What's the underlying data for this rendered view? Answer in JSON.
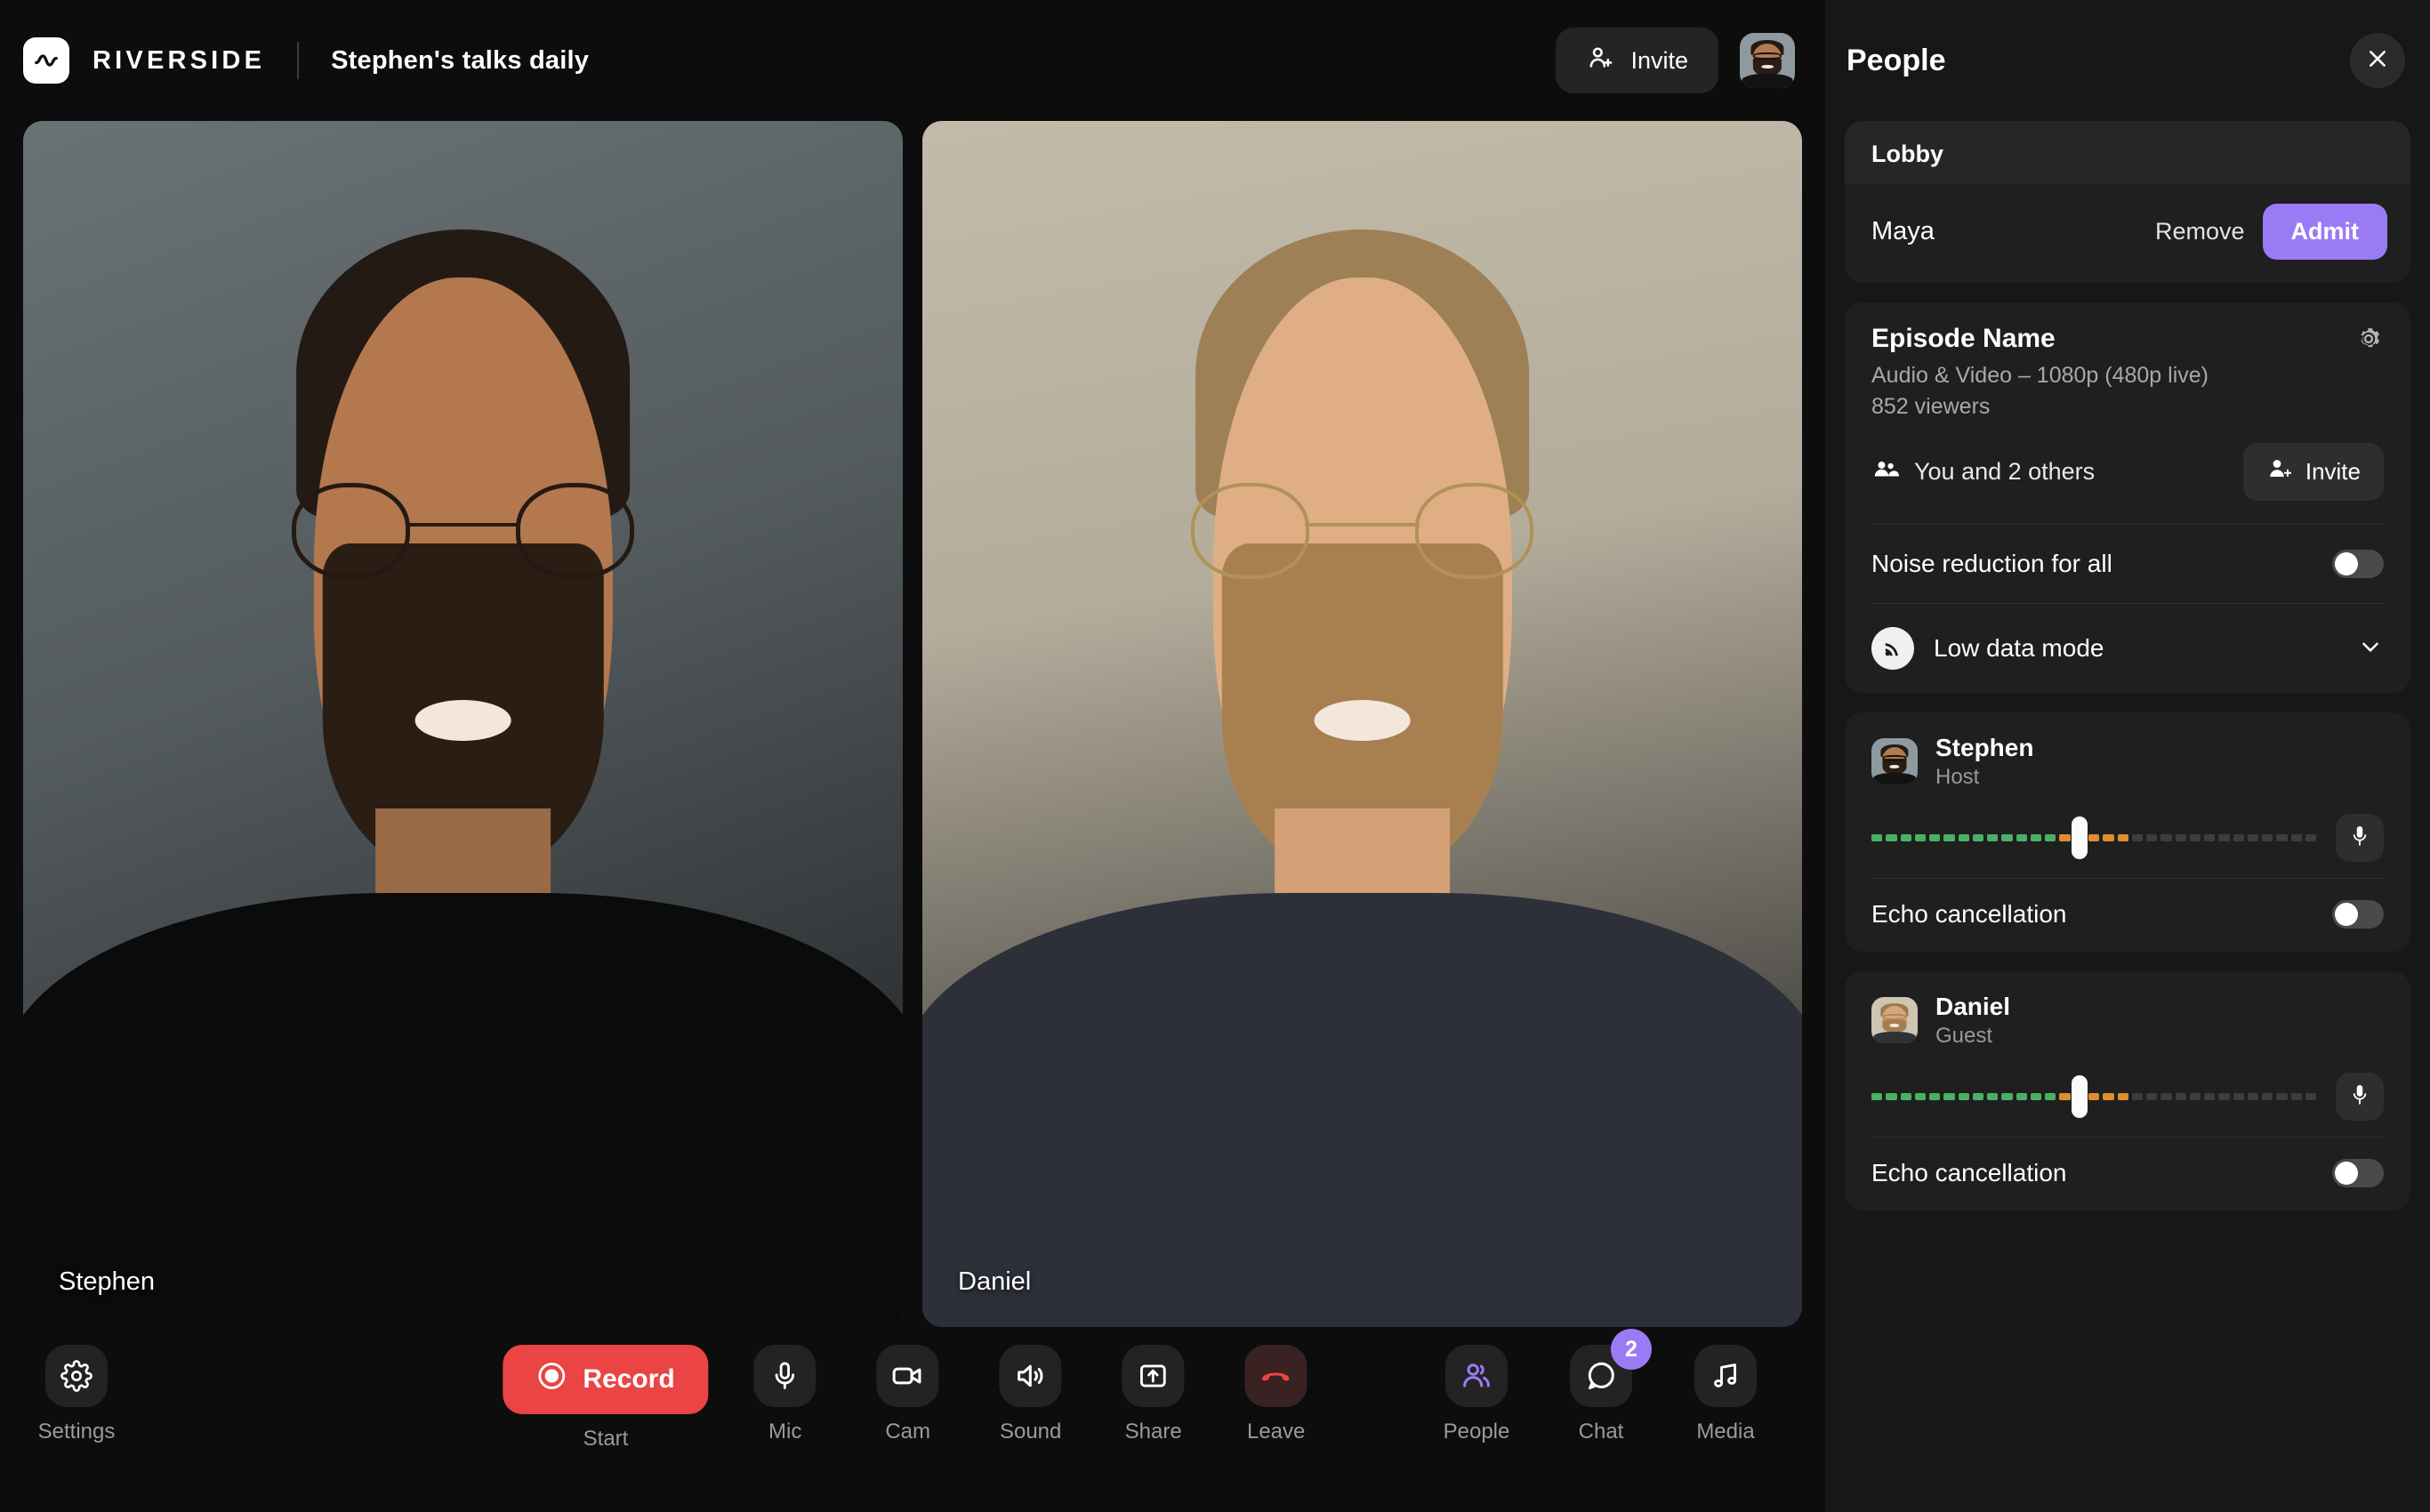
{
  "header": {
    "brand_name": "RIVERSIDE",
    "logo_icon": "riverside-wave-icon",
    "room_title": "Stephen's talks daily",
    "invite_label": "Invite",
    "invite_icon": "person-add-icon",
    "avatar_name": "Stephen"
  },
  "video": {
    "tiles": [
      {
        "name": "Stephen"
      },
      {
        "name": "Daniel"
      }
    ]
  },
  "toolbar": {
    "settings": {
      "label": "Settings",
      "icon": "gear-icon"
    },
    "record": {
      "label": "Record",
      "sublabel": "Start",
      "icon": "record-circle-icon",
      "color": "#ea4444"
    },
    "center": [
      {
        "label": "Mic",
        "icon": "microphone-icon"
      },
      {
        "label": "Cam",
        "icon": "video-camera-icon"
      },
      {
        "label": "Sound",
        "icon": "speaker-icon"
      },
      {
        "label": "Share",
        "icon": "share-upload-icon"
      },
      {
        "label": "Leave",
        "icon": "phone-hangup-icon"
      }
    ],
    "right": [
      {
        "label": "People",
        "icon": "people-icon",
        "active": true,
        "badge": ""
      },
      {
        "label": "Chat",
        "icon": "chat-bubble-icon",
        "active": false,
        "badge": "2"
      },
      {
        "label": "Media",
        "icon": "music-note-icon",
        "active": false,
        "badge": ""
      }
    ]
  },
  "panel": {
    "title": "People",
    "close_icon": "close-icon",
    "lobby": {
      "heading": "Lobby",
      "person": "Maya",
      "remove_label": "Remove",
      "admit_label": "Admit"
    },
    "episode": {
      "name": "Episode Name",
      "quality": "Audio & Video – 1080p (480p live)",
      "viewers": "852 viewers",
      "gear_icon": "gear-icon",
      "members": "You and 2 others",
      "members_icon": "people-group-icon",
      "invite_label": "Invite",
      "invite_icon": "person-add-icon"
    },
    "noise_reduction": {
      "label": "Noise reduction for all",
      "enabled": false
    },
    "low_data_mode": {
      "label": "Low data mode",
      "icon": "signal-icon",
      "chevron": "chevron-down-icon"
    },
    "participants": [
      {
        "name": "Stephen",
        "role": "Host",
        "mic_icon": "microphone-icon",
        "echo_label": "Echo cancellation",
        "echo_enabled": false,
        "meter": {
          "green": 13,
          "orange": 5,
          "gray": 13,
          "handle_percent": 45
        }
      },
      {
        "name": "Daniel",
        "role": "Guest",
        "mic_icon": "microphone-icon",
        "echo_label": "Echo cancellation",
        "echo_enabled": false,
        "meter": {
          "green": 13,
          "orange": 5,
          "gray": 13,
          "handle_percent": 45
        }
      }
    ]
  },
  "colors": {
    "accent_purple": "#9b7bf5",
    "record_red": "#ea4444",
    "meter_green": "#4caf66",
    "meter_orange": "#e08d2e",
    "meter_gray": "#3d3d3d"
  }
}
